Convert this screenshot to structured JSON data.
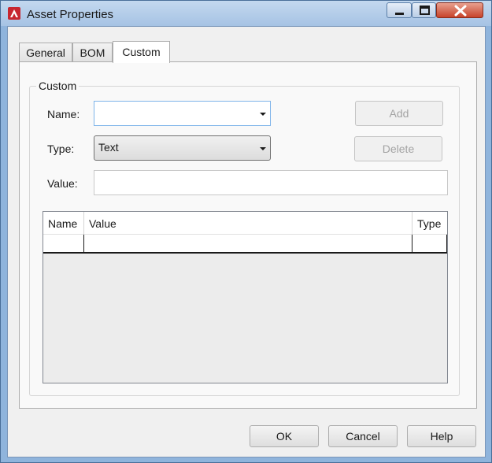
{
  "window": {
    "title": "Asset Properties",
    "app_icon": "autocad-logo-icon",
    "accent": "#c7432a"
  },
  "tabs": [
    {
      "label": "General",
      "active": false
    },
    {
      "label": "BOM",
      "active": false
    },
    {
      "label": "Custom",
      "active": true
    }
  ],
  "custom_group": {
    "title": "Custom",
    "name_label": "Name:",
    "name_value": "",
    "type_label": "Type:",
    "type_value": "Text",
    "value_label": "Value:",
    "value_value": "",
    "add_label": "Add",
    "delete_label": "Delete"
  },
  "grid": {
    "columns": [
      "Name",
      "Value",
      "Type"
    ],
    "rows": [
      [
        "",
        "",
        ""
      ]
    ]
  },
  "footer": {
    "ok_label": "OK",
    "cancel_label": "Cancel",
    "help_label": "Help"
  },
  "icons": {
    "minimize": "minimize-icon",
    "maximize": "maximize-icon",
    "close": "close-icon",
    "dropdown": "chevron-down-icon"
  }
}
